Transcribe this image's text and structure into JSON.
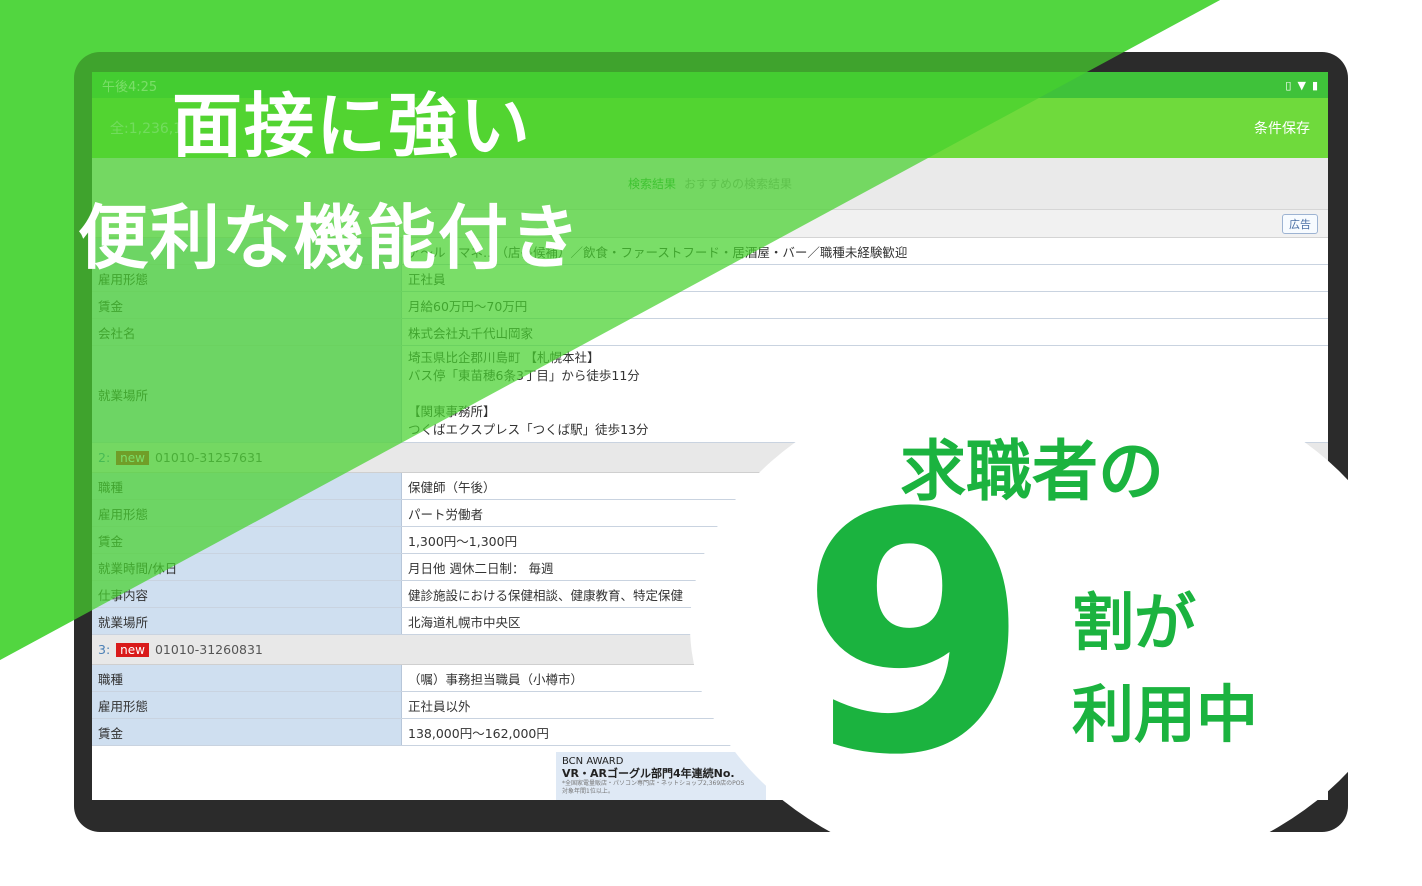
{
  "status_bar": {
    "time": "午後4:25",
    "icons": [
      "vibrate-icon",
      "wifi-icon",
      "battery-icon"
    ]
  },
  "app_bar": {
    "count": "全:1,236,1",
    "save_conditions": "条件保存"
  },
  "tabs": {
    "active": "検索結果",
    "inactive": "おすすめの検索結果"
  },
  "ad_badge": "広告",
  "record1": {
    "rows": [
      {
        "key": "",
        "value": "ア〜ル・マネ…（店長候補）／飲食・ファーストフード・居酒屋・バー／職種未経験歓迎"
      },
      {
        "key": "雇用形態",
        "value": "正社員"
      },
      {
        "key": "賃金",
        "value": "月給60万円〜70万円"
      },
      {
        "key": "会社名",
        "value": "株式会社丸千代山岡家"
      }
    ],
    "location_key": "就業場所",
    "location_lines": [
      "埼玉県比企郡川島町 【札幌本社】",
      "バス停「東苗穂6条3丁目」から徒歩11分",
      "",
      "【関東事務所】",
      "つくばエクスプレス「つくば駅」徒歩13分"
    ]
  },
  "record2": {
    "index": "2:",
    "new_label": "new",
    "id": "01010-31257631",
    "rows": [
      {
        "key": "職種",
        "value": "保健師（午後）"
      },
      {
        "key": "雇用形態",
        "value": "パート労働者"
      },
      {
        "key": "賃金",
        "value": "1,300円〜1,300円"
      },
      {
        "key": "就業時間/休日",
        "value": "月日他 週休二日制： 毎週"
      },
      {
        "key": "仕事内容",
        "value": "健診施設における保健相談、健康教育、特定保健"
      },
      {
        "key": "就業場所",
        "value": "北海道札幌市中央区"
      }
    ]
  },
  "record3": {
    "index": "3:",
    "new_label": "new",
    "id": "01010-31260831",
    "rows": [
      {
        "key": "職種",
        "value": "（嘱）事務担当職員（小樽市）"
      },
      {
        "key": "雇用形態",
        "value": "正社員以外"
      },
      {
        "key": "賃金",
        "value": "138,000円〜162,000円"
      }
    ]
  },
  "banner": {
    "line1": "BCN AWARD",
    "line2": "VR・ARゴーグル部門4年連続No.",
    "line3": "*全国家電量販店・パソコン専門店・ネットショップ2,369店のPOS",
    "line4": "対象年間1位以上。"
  },
  "promo": {
    "headline1": "面接に強い",
    "headline2": "便利な機能付き",
    "bubble_line1": "求職者の",
    "bubble_number": "9",
    "bubble_line2": "割が",
    "bubble_line3": "利用中"
  },
  "colors": {
    "brand_green": "#1bb33f",
    "overlay_green": "#47d532",
    "key_cell": "#cfdff0"
  }
}
